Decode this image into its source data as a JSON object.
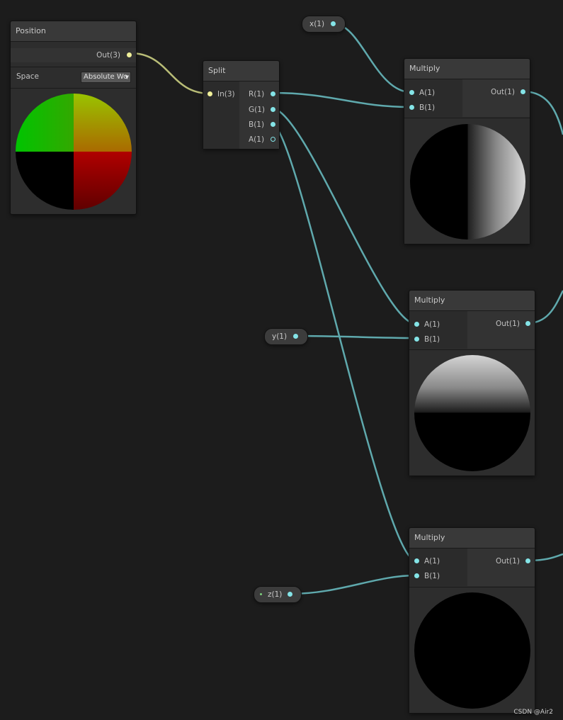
{
  "nodes": {
    "position": {
      "title": "Position",
      "out_port": "Out(3)",
      "space_label": "Space",
      "space_value": "Absolute Wo"
    },
    "split": {
      "title": "Split",
      "in_port": "In(3)",
      "out_ports": [
        "R(1)",
        "G(1)",
        "B(1)",
        "A(1)"
      ]
    },
    "multiply_1": {
      "title": "Multiply",
      "in_a": "A(1)",
      "in_b": "B(1)",
      "out": "Out(1)"
    },
    "multiply_2": {
      "title": "Multiply",
      "in_a": "A(1)",
      "in_b": "B(1)",
      "out": "Out(1)"
    },
    "multiply_3": {
      "title": "Multiply",
      "in_a": "A(1)",
      "in_b": "B(1)",
      "out": "Out(1)"
    }
  },
  "properties": {
    "x": "x(1)",
    "y": "y(1)",
    "z": "z(1)"
  },
  "watermark": "CSDN @Air2",
  "colors": {
    "background": "#1c1c1c",
    "float_wire": "#5fa9ad",
    "vector3_wire": "#b9bd77",
    "float_port": "#84e4e7",
    "vector3_port": "#f0f09a"
  }
}
